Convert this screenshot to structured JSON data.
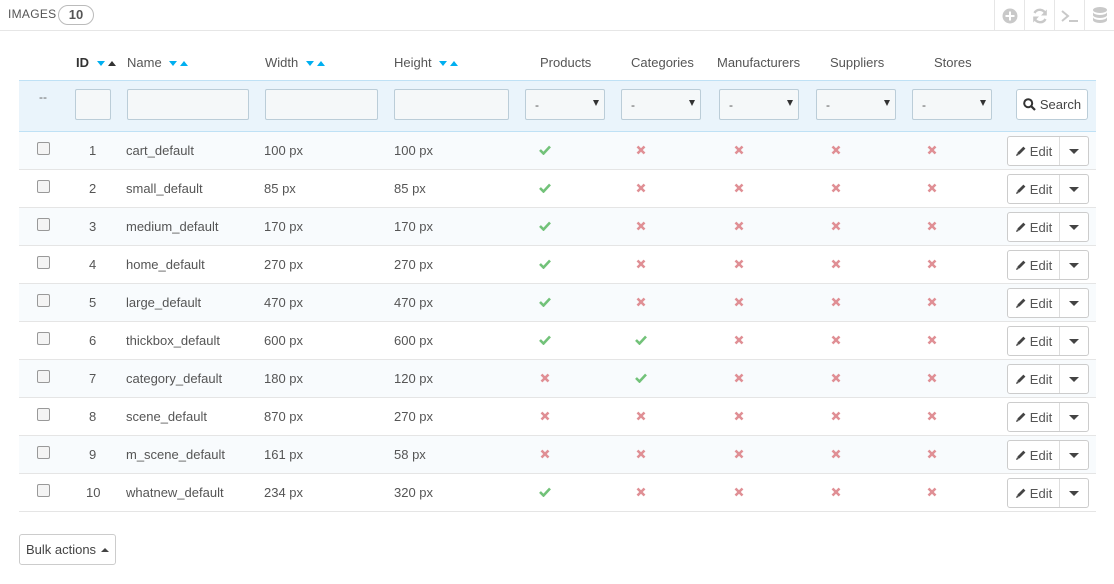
{
  "panel": {
    "title": "IMAGES",
    "count": "10"
  },
  "toolbar": {
    "icons": [
      "add-icon",
      "refresh-icon",
      "terminal-icon",
      "database-icon"
    ]
  },
  "columns": {
    "id": "ID",
    "name": "Name",
    "width": "Width",
    "height": "Height",
    "products": "Products",
    "categories": "Categories",
    "manufacturers": "Manufacturers",
    "suppliers": "Suppliers",
    "stores": "Stores"
  },
  "filters": {
    "dash": "--",
    "select_value": "-",
    "search_label": "Search"
  },
  "colors": {
    "yes": "#72c279",
    "no": "#e08f95",
    "accent": "#00aff0"
  },
  "rows": [
    {
      "id": "1",
      "name": "cart_default",
      "width": "100 px",
      "height": "100 px",
      "products": true,
      "categories": false,
      "manufacturers": false,
      "suppliers": false,
      "stores": false
    },
    {
      "id": "2",
      "name": "small_default",
      "width": "85 px",
      "height": "85 px",
      "products": true,
      "categories": false,
      "manufacturers": false,
      "suppliers": false,
      "stores": false
    },
    {
      "id": "3",
      "name": "medium_default",
      "width": "170 px",
      "height": "170 px",
      "products": true,
      "categories": false,
      "manufacturers": false,
      "suppliers": false,
      "stores": false
    },
    {
      "id": "4",
      "name": "home_default",
      "width": "270 px",
      "height": "270 px",
      "products": true,
      "categories": false,
      "manufacturers": false,
      "suppliers": false,
      "stores": false
    },
    {
      "id": "5",
      "name": "large_default",
      "width": "470 px",
      "height": "470 px",
      "products": true,
      "categories": false,
      "manufacturers": false,
      "suppliers": false,
      "stores": false
    },
    {
      "id": "6",
      "name": "thickbox_default",
      "width": "600 px",
      "height": "600 px",
      "products": true,
      "categories": true,
      "manufacturers": false,
      "suppliers": false,
      "stores": false
    },
    {
      "id": "7",
      "name": "category_default",
      "width": "180 px",
      "height": "120 px",
      "products": false,
      "categories": true,
      "manufacturers": false,
      "suppliers": false,
      "stores": false
    },
    {
      "id": "8",
      "name": "scene_default",
      "width": "870 px",
      "height": "270 px",
      "products": false,
      "categories": false,
      "manufacturers": false,
      "suppliers": false,
      "stores": false
    },
    {
      "id": "9",
      "name": "m_scene_default",
      "width": "161 px",
      "height": "58 px",
      "products": false,
      "categories": false,
      "manufacturers": false,
      "suppliers": false,
      "stores": false
    },
    {
      "id": "10",
      "name": "whatnew_default",
      "width": "234 px",
      "height": "320 px",
      "products": true,
      "categories": false,
      "manufacturers": false,
      "suppliers": false,
      "stores": false
    }
  ],
  "row_action": {
    "edit_label": "Edit"
  },
  "bulk_actions": {
    "label": "Bulk actions"
  }
}
